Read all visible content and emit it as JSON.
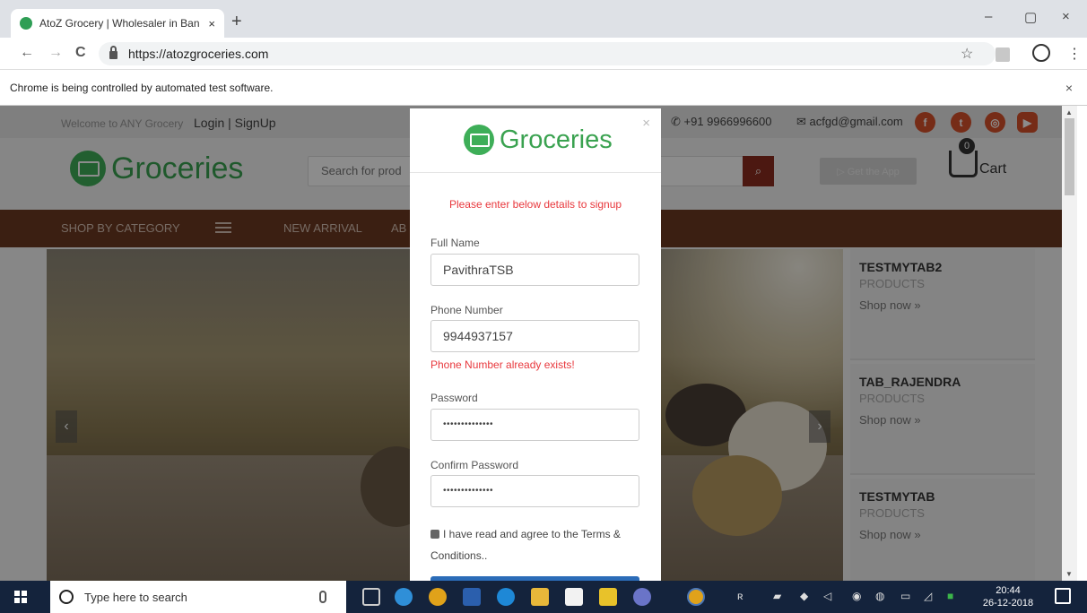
{
  "browser": {
    "tab_title": "AtoZ Grocery | Wholesaler in Ban",
    "tab_close": "×",
    "new_tab": "+",
    "url": "https://atozgroceries.com",
    "window_controls": {
      "minimize": "–",
      "restore": "▢",
      "close": "×"
    },
    "nav": {
      "back": "←",
      "forward": "→",
      "reload": "C"
    },
    "star": "☆",
    "menu": "⋮",
    "infobar_text": "Chrome is being controlled by automated test software.",
    "infobar_close": "×"
  },
  "site": {
    "topbar": {
      "welcome": "Welcome to ANY Grocery",
      "login_signup": "Login | SignUp",
      "phone": "+91 9966996600",
      "email": "acfgd@gmail.com",
      "socials": [
        {
          "name": "facebook",
          "glyph": "f",
          "color": "#d8502a"
        },
        {
          "name": "twitter",
          "glyph": "t",
          "color": "#d8502a"
        },
        {
          "name": "instagram",
          "glyph": "◎",
          "color": "#d8502a"
        },
        {
          "name": "youtube",
          "glyph": "▶",
          "color": "#d8502a"
        }
      ]
    },
    "header": {
      "logo_text": "Groceries",
      "search_placeholder": "Search for prod",
      "search_icon": "⌕",
      "get_app": "▷ Get the App",
      "cart_count": "0",
      "cart_label": "Cart"
    },
    "navbar": {
      "shop_by_category": "SHOP BY CATEGORY",
      "new_arrival": "NEW ARRIVAL",
      "about": "AB"
    },
    "hero": {
      "prev": "‹",
      "next": "›"
    },
    "cards": [
      {
        "name": "TESTMYTAB2",
        "sub": "PRODUCTS",
        "cta": "Shop now »"
      },
      {
        "name": "TAB_RAJENDRA",
        "sub": "PRODUCTS",
        "cta": "Shop now »"
      },
      {
        "name": "TESTMYTAB",
        "sub": "PRODUCTS",
        "cta": "Shop now »"
      }
    ]
  },
  "modal": {
    "logo_text": "Groceries",
    "close": "×",
    "notice": "Please enter below details to signup",
    "full_name": {
      "label": "Full Name",
      "value": "PavithraTSB"
    },
    "phone": {
      "label": "Phone Number",
      "value": "9944937157",
      "error": "Phone Number already exists!"
    },
    "password": {
      "label": "Password",
      "value": "••••••••••••••"
    },
    "confirm_password": {
      "label": "Confirm Password",
      "value": "••••••••••••••"
    },
    "terms_line1": "I have read and agree to the Terms &",
    "terms_line2": "Conditions.."
  },
  "taskbar": {
    "search_placeholder": "Type here to search",
    "time": "20:44",
    "date": "26-12-2018",
    "notification_count": "1"
  }
}
